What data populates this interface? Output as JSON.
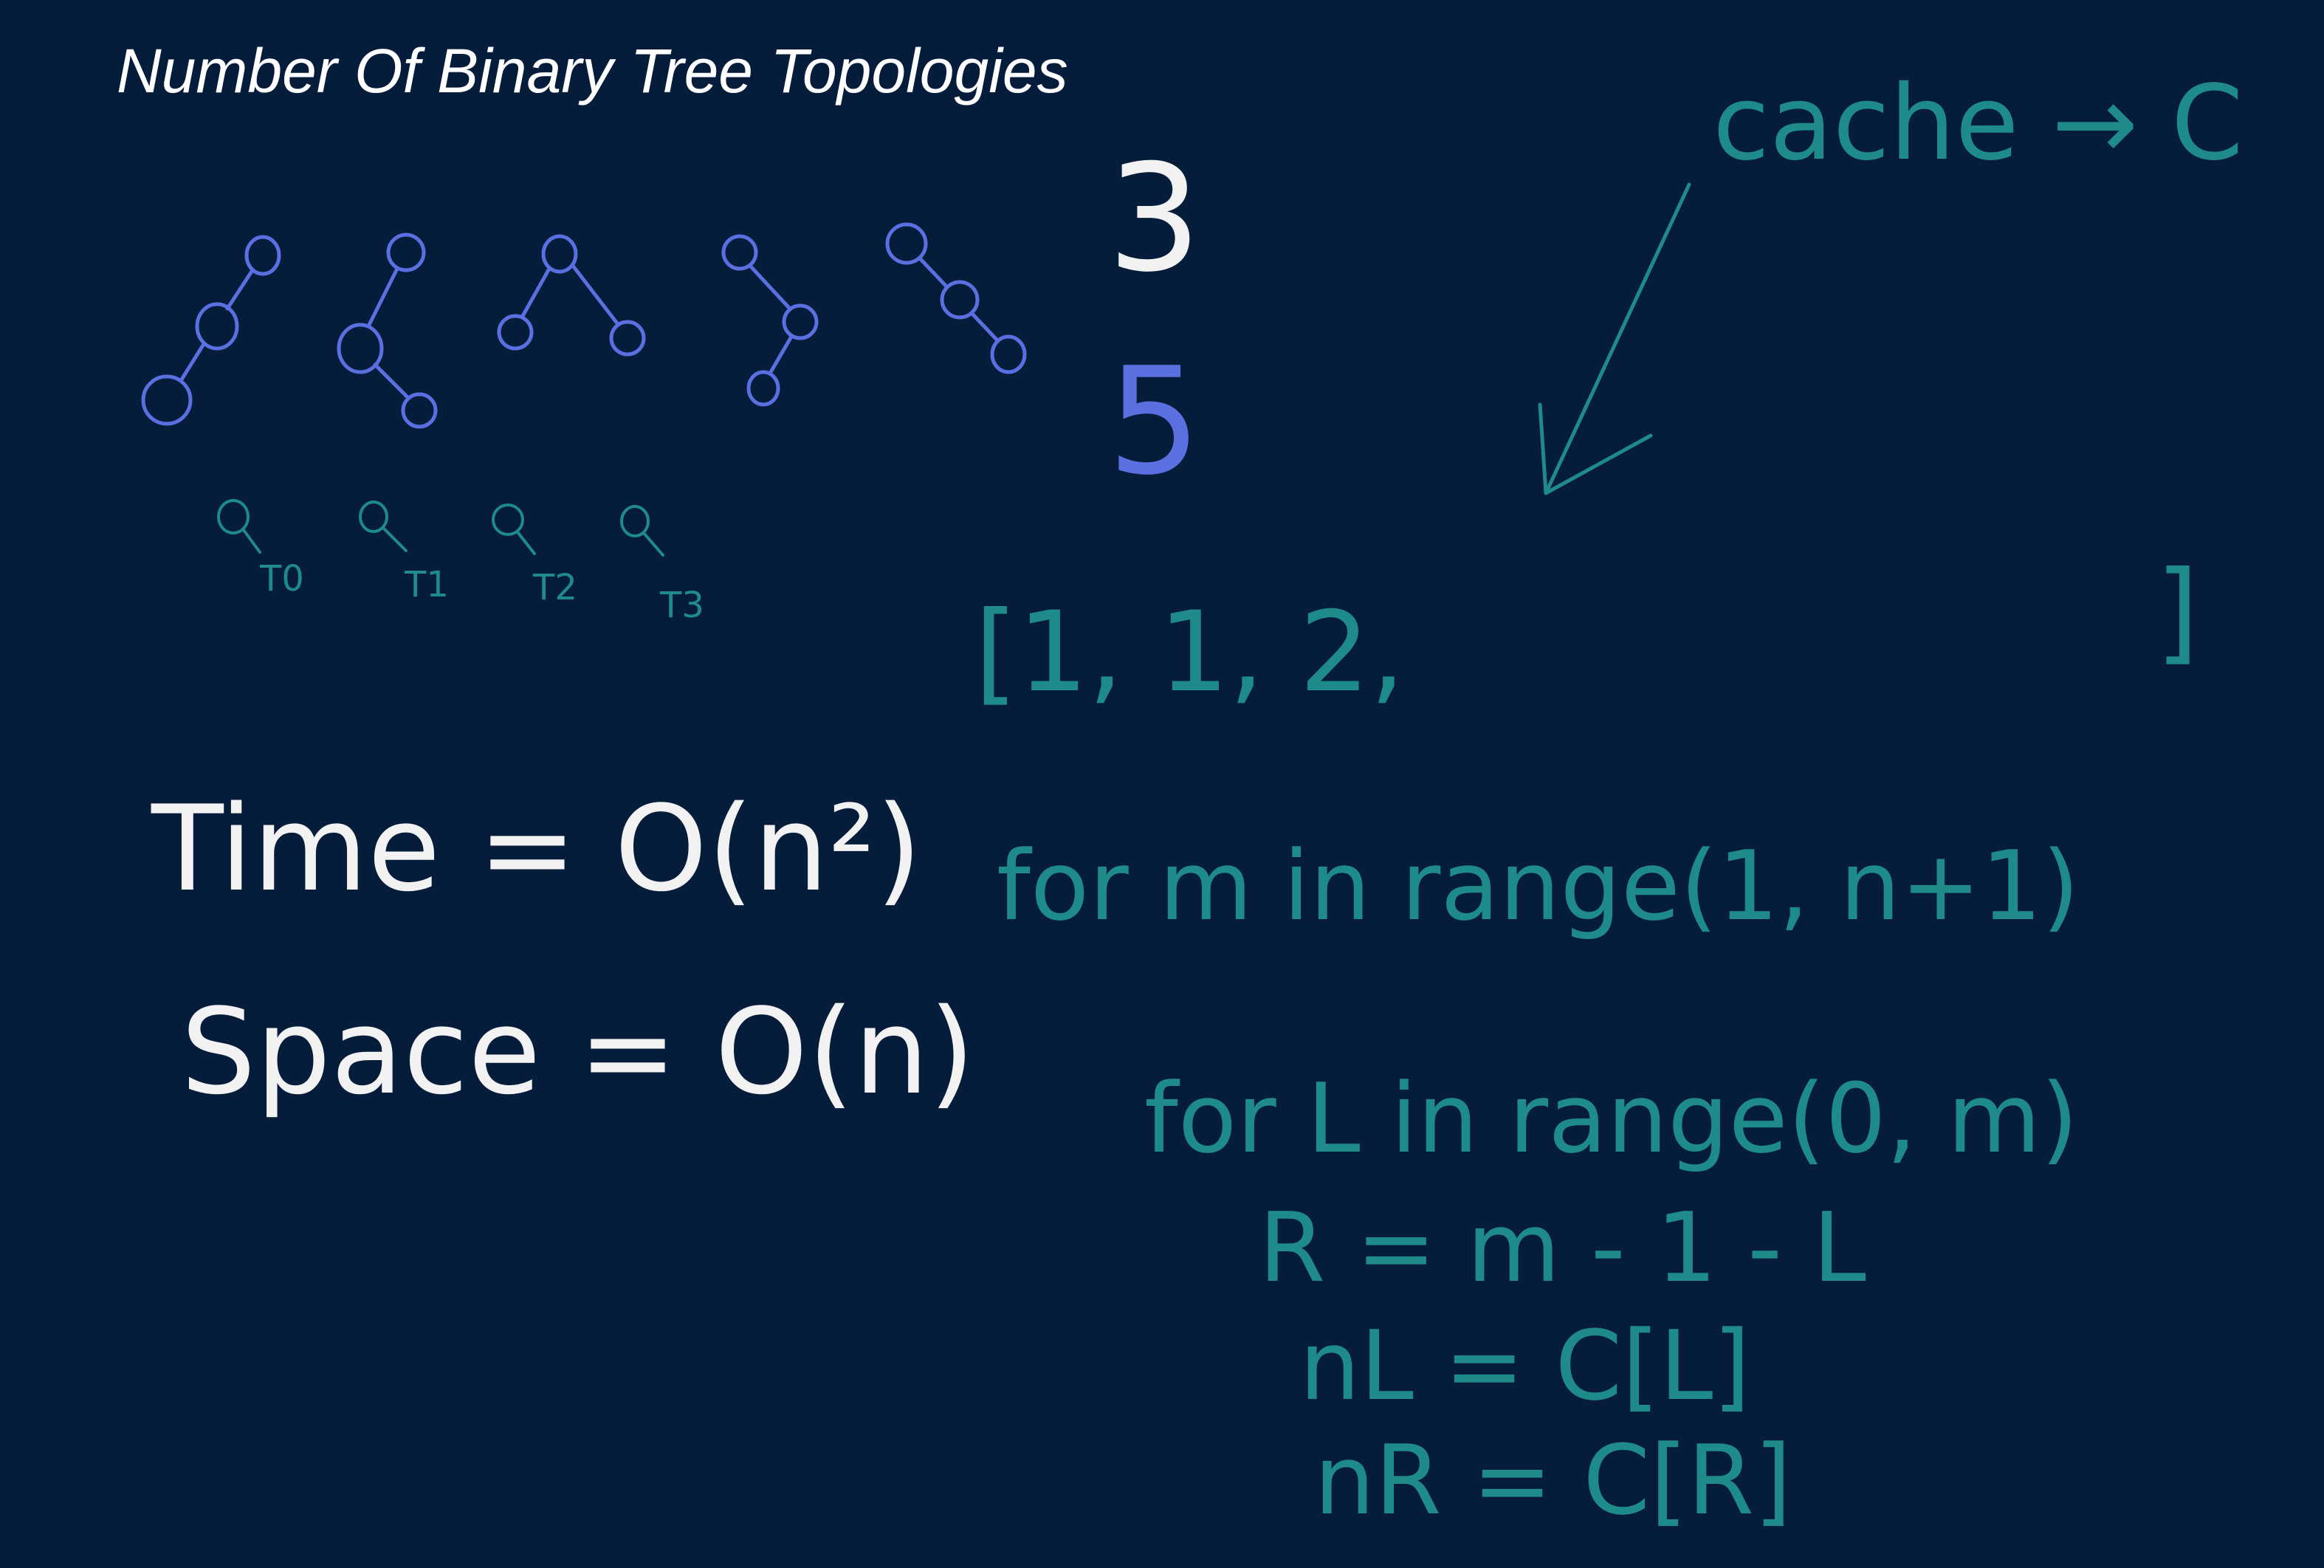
{
  "title": "Number Of Binary Tree Topologies",
  "colors": {
    "background": "#051c3b",
    "title": "#ffffff",
    "white_ink": "#f2f2f2",
    "blue_ink": "#5a6fe0",
    "teal_ink": "#1f8a8a"
  },
  "counts": {
    "three": "3",
    "five": "5"
  },
  "tree_labels": [
    "T0",
    "T1",
    "T2",
    "T3"
  ],
  "complexity": {
    "time": "Time = O(n²)",
    "space": "Space = O(n)"
  },
  "code": {
    "cache": "cache → C",
    "array": "[1, 1, 2,",
    "array_close": "]",
    "lines": [
      "for m in range(1, n+1)",
      "for L in range(0, m)",
      "R = m - 1 - L",
      "nL = C[L]",
      "nR = C[R]"
    ]
  }
}
